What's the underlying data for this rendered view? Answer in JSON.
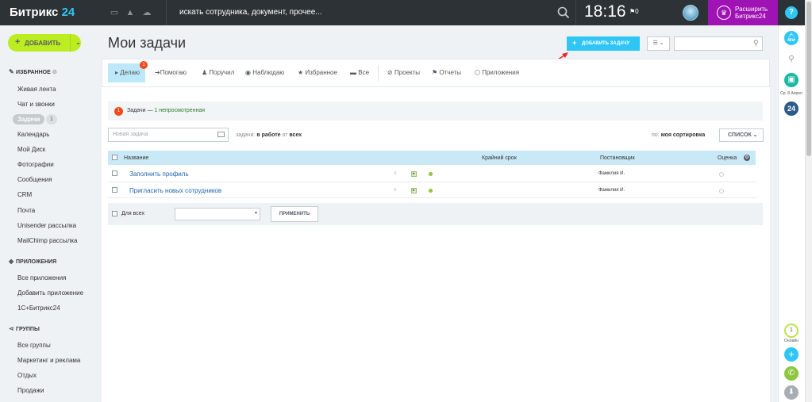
{
  "topbar": {
    "logo_text": "Битрикс",
    "logo_num": "24",
    "search_placeholder": "искать сотрудника, документ, прочее...",
    "time": "18:16",
    "flag_count": "0",
    "upgrade_line1": "Расширить",
    "upgrade_line2": "Битрикс24",
    "help": "?"
  },
  "sidebar": {
    "add_button": "ДОБАВИТЬ",
    "favorites_header": "ИЗБРАННОЕ",
    "favorites": [
      "Живая лента",
      "Чат и звонки"
    ],
    "active_item": "Задачи",
    "active_count": "1",
    "favorites_rest": [
      "Календарь",
      "Мой Диск",
      "Фотографии",
      "Сообщения",
      "CRM",
      "Почта",
      "Unisender рассылка",
      "MailChimp рассылка"
    ],
    "apps_header": "ПРИЛОЖЕНИЯ",
    "apps": [
      "Все приложения",
      "Добавить приложение",
      "1С+Битрикс24"
    ],
    "groups_header": "ГРУППЫ",
    "groups": [
      "Все группы",
      "Маркетинг и реклама",
      "Отдых",
      "Продажи"
    ]
  },
  "header": {
    "title": "Мои задачи",
    "add_task": "ДОБАВИТЬ ЗАДАЧУ"
  },
  "nav": {
    "items": [
      "Делаю",
      "Помогаю",
      "Поручил",
      "Наблюдаю",
      "Избранное",
      "Все",
      "Проекты",
      "Отчеты",
      "Приложения"
    ],
    "badge": "1"
  },
  "notice": {
    "badge": "1",
    "prefix": "Задачи — ",
    "link": "1 непросмотренная"
  },
  "filters": {
    "new_task_placeholder": "Новая задача",
    "tasks_label": "задачи:",
    "status": "в работе",
    "from_label": "от",
    "from_value": "всех",
    "sort_label": "по:",
    "sort_value": "моя сортировка",
    "list_button": "СПИСОК"
  },
  "table": {
    "columns": [
      "Название",
      "Крайний срок",
      "Постановщик",
      "Оценка"
    ],
    "rows": [
      {
        "title": "Заполнить профиль",
        "author": "Фамилия И."
      },
      {
        "title": "Пригласить новых сотрудников",
        "author": "Фамилия И."
      }
    ]
  },
  "footer": {
    "for_all": "Для всех",
    "apply": "ПРИМЕНИТЬ"
  },
  "rail": {
    "calendar_label": "Ср. 8 Апрел",
    "b24": "24",
    "online_count": "1",
    "online_label": "Онлайн"
  }
}
